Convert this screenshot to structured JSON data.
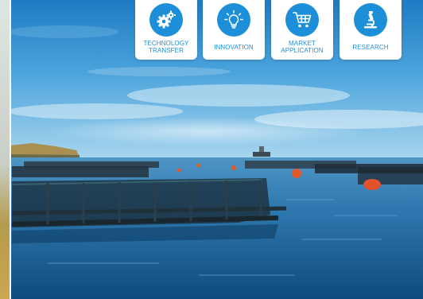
{
  "nav_cards": [
    {
      "label": "TECHNOLOGY TRANSFER",
      "icon": "gears-icon"
    },
    {
      "label": "INNOVATION",
      "icon": "lightbulb-icon"
    },
    {
      "label": "MARKET APPLICATION",
      "icon": "shopping-cart-icon"
    },
    {
      "label": "RESEARCH",
      "icon": "microscope-icon"
    }
  ],
  "colors": {
    "accent": "#1d8fd8",
    "card_bg": "#ffffff",
    "sea": "#0e4f82"
  }
}
